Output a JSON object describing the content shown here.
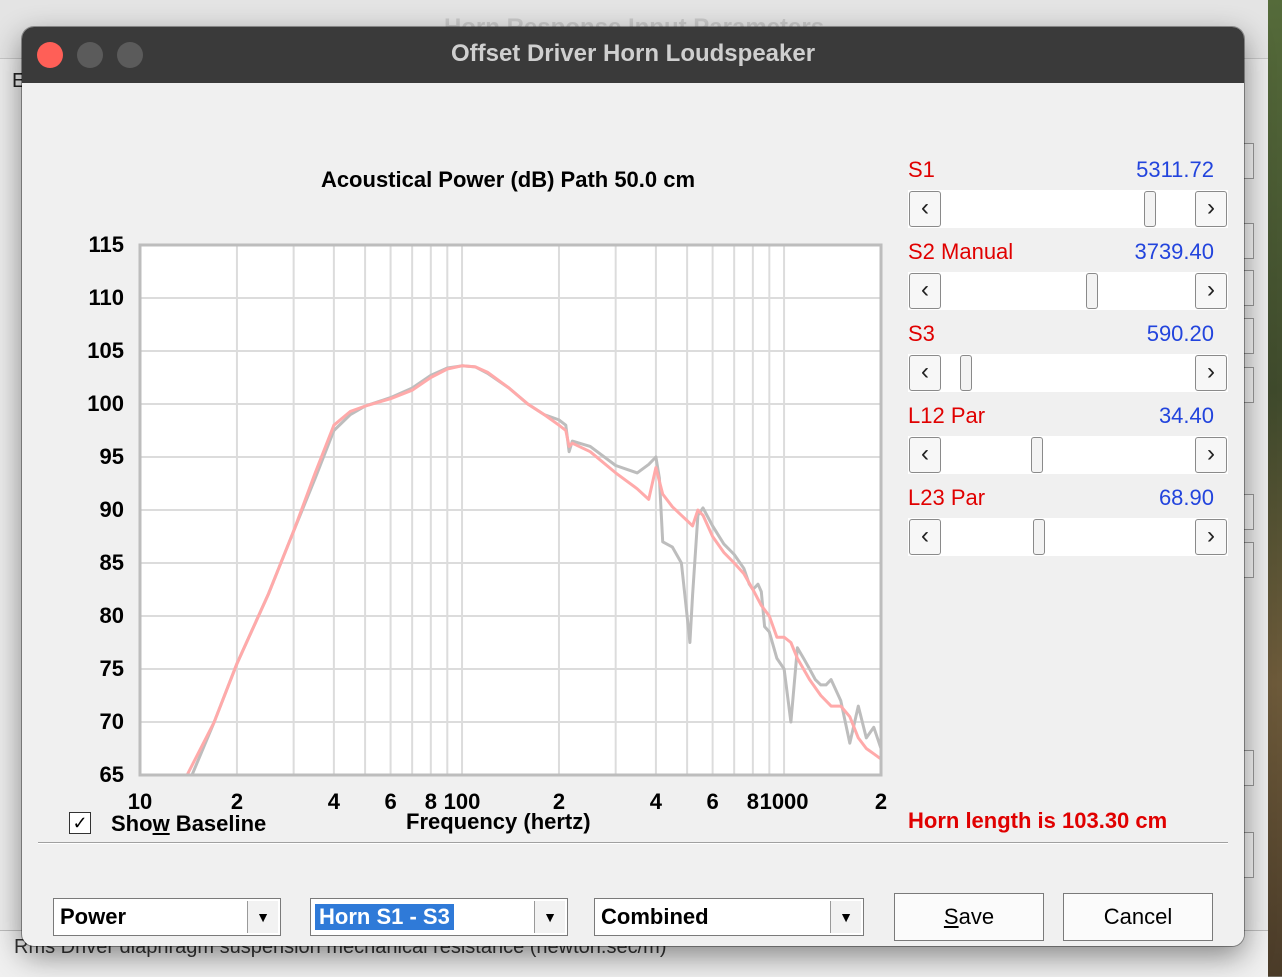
{
  "background": {
    "window_title": "Horn Response Input Parameters",
    "menu_letter": "E",
    "status_text": "Rms   Driver diaphragm suspension mechanical resistance  (newton.sec/m)"
  },
  "dialog": {
    "title": "Offset Driver Horn Loudspeaker"
  },
  "chart_data": {
    "type": "line",
    "title": "Acoustical Power (dB)   Path 50.0 cm",
    "xlabel": "Frequency (hertz)",
    "ylabel": "",
    "x_scale": "log",
    "xlim": [
      10,
      2000
    ],
    "ylim": [
      65,
      115
    ],
    "grid": true,
    "y_ticks": [
      115,
      110,
      105,
      100,
      95,
      90,
      85,
      80,
      75,
      70,
      65
    ],
    "x_tick_labels": [
      {
        "x": 10,
        "label": "10"
      },
      {
        "x": 20,
        "label": "2"
      },
      {
        "x": 40,
        "label": "4"
      },
      {
        "x": 60,
        "label": "6"
      },
      {
        "x": 80,
        "label": "8"
      },
      {
        "x": 100,
        "label": "100"
      },
      {
        "x": 200,
        "label": "2"
      },
      {
        "x": 400,
        "label": "4"
      },
      {
        "x": 600,
        "label": "6"
      },
      {
        "x": 800,
        "label": "8"
      },
      {
        "x": 1000,
        "label": "1000"
      },
      {
        "x": 2000,
        "label": "2"
      }
    ],
    "series": [
      {
        "color": "#bdbdbd",
        "x": [
          14.5,
          17,
          20,
          25,
          30,
          35,
          40,
          45,
          50,
          60,
          70,
          80,
          90,
          100,
          110,
          120,
          140,
          160,
          180,
          200,
          210,
          215,
          220,
          250,
          300,
          350,
          380,
          400,
          410,
          420,
          450,
          480,
          500,
          510,
          520,
          540,
          560,
          600,
          650,
          700,
          750,
          780,
          800,
          830,
          850,
          870,
          900,
          950,
          1000,
          1050,
          1100,
          1150,
          1200,
          1250,
          1300,
          1350,
          1400,
          1500,
          1600,
          1700,
          1800,
          1900,
          2000
        ],
        "y": [
          65,
          70,
          75.5,
          82,
          88,
          93,
          97.5,
          99,
          99.8,
          100.6,
          101.5,
          102.7,
          103.4,
          103.6,
          103.5,
          102.9,
          101.5,
          100,
          99,
          98.5,
          98,
          95.5,
          96.5,
          96,
          94.2,
          93.5,
          94.3,
          95,
          93,
          87,
          86.5,
          85,
          80,
          77.5,
          82,
          89.5,
          90.2,
          88.5,
          86.8,
          85.8,
          84.5,
          83,
          82.5,
          83,
          82.3,
          79,
          78.5,
          76,
          75,
          70,
          77,
          76,
          75,
          74,
          73.5,
          73.5,
          74,
          72,
          68,
          71.5,
          68.5,
          69.5,
          67.5
        ]
      },
      {
        "color": "#ffaaaa",
        "x": [
          14,
          17,
          20,
          25,
          30,
          35,
          40,
          45,
          50,
          60,
          70,
          80,
          90,
          100,
          110,
          120,
          140,
          160,
          180,
          200,
          210,
          215,
          220,
          250,
          300,
          350,
          380,
          400,
          420,
          450,
          480,
          500,
          520,
          540,
          560,
          600,
          650,
          700,
          750,
          800,
          850,
          900,
          950,
          1000,
          1050,
          1100,
          1200,
          1300,
          1400,
          1500,
          1600,
          1700,
          1800,
          1900,
          2000
        ],
        "y": [
          65,
          70,
          75.5,
          82,
          88,
          93.5,
          98,
          99.3,
          99.8,
          100.5,
          101.3,
          102.5,
          103.3,
          103.6,
          103.5,
          103,
          101.5,
          100,
          99,
          98,
          97.5,
          96,
          96.3,
          95.5,
          93.5,
          92,
          91,
          94,
          91.5,
          90.3,
          89.5,
          89,
          88.5,
          90,
          89.5,
          87.5,
          86,
          85,
          84,
          82.5,
          81,
          80,
          78,
          78,
          77.5,
          76,
          74,
          72.5,
          71.5,
          71.5,
          70.5,
          68.5,
          67.5,
          67,
          66.5
        ]
      }
    ]
  },
  "controls": {
    "show_baseline": {
      "label_pre": "Sho",
      "label_ul": "w",
      "label_post": " Baseline",
      "checked": true,
      "check_glyph": "✓"
    },
    "params": [
      {
        "label": "S1",
        "value": "5311.72",
        "fraction": 0.84
      },
      {
        "label": "S2  Manual",
        "value": "3739.40",
        "fraction": 0.6
      },
      {
        "label": "S3",
        "value": "590.20",
        "fraction": 0.08
      },
      {
        "label": "L12  Par",
        "value": "34.40",
        "fraction": 0.37
      },
      {
        "label": "L23  Par",
        "value": "68.90",
        "fraction": 0.38
      }
    ],
    "horn_length_text": "Horn length is 103.30 cm",
    "combo_type": "Power",
    "combo_horn": "Horn S1 - S3",
    "combo_mode": "Combined",
    "save_ul": "S",
    "save_rest": "ave",
    "cancel_label": "Cancel",
    "arrow_left": "‹",
    "arrow_right": "›",
    "combo_arrow": "▼"
  }
}
